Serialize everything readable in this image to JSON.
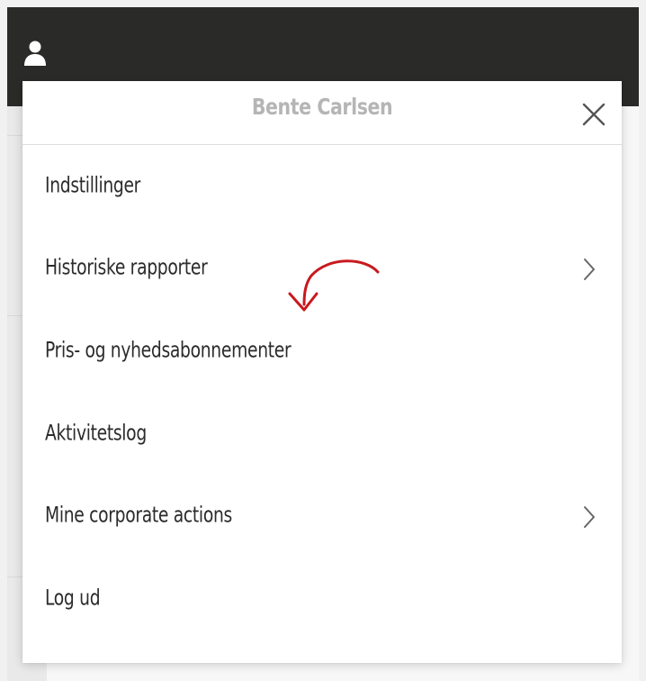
{
  "header": {
    "user_icon": "user-icon"
  },
  "menu": {
    "title": "Bente Carlsen",
    "close_icon": "close-icon",
    "items": [
      {
        "label": "Indstillinger",
        "has_submenu": false
      },
      {
        "label": "Historiske rapporter",
        "has_submenu": true
      },
      {
        "label": "Pris- og nyhedsabonnementer",
        "has_submenu": false
      },
      {
        "label": "Aktivitetslog",
        "has_submenu": false
      },
      {
        "label": "Mine corporate actions",
        "has_submenu": true
      },
      {
        "label": "Log ud",
        "has_submenu": false
      }
    ]
  },
  "annotation": {
    "icon": "curved-arrow-icon",
    "color": "#c8191e"
  },
  "colors": {
    "top_bar": "#2a2a28",
    "title": "#b5b5b5",
    "text": "#2b2b2b"
  }
}
